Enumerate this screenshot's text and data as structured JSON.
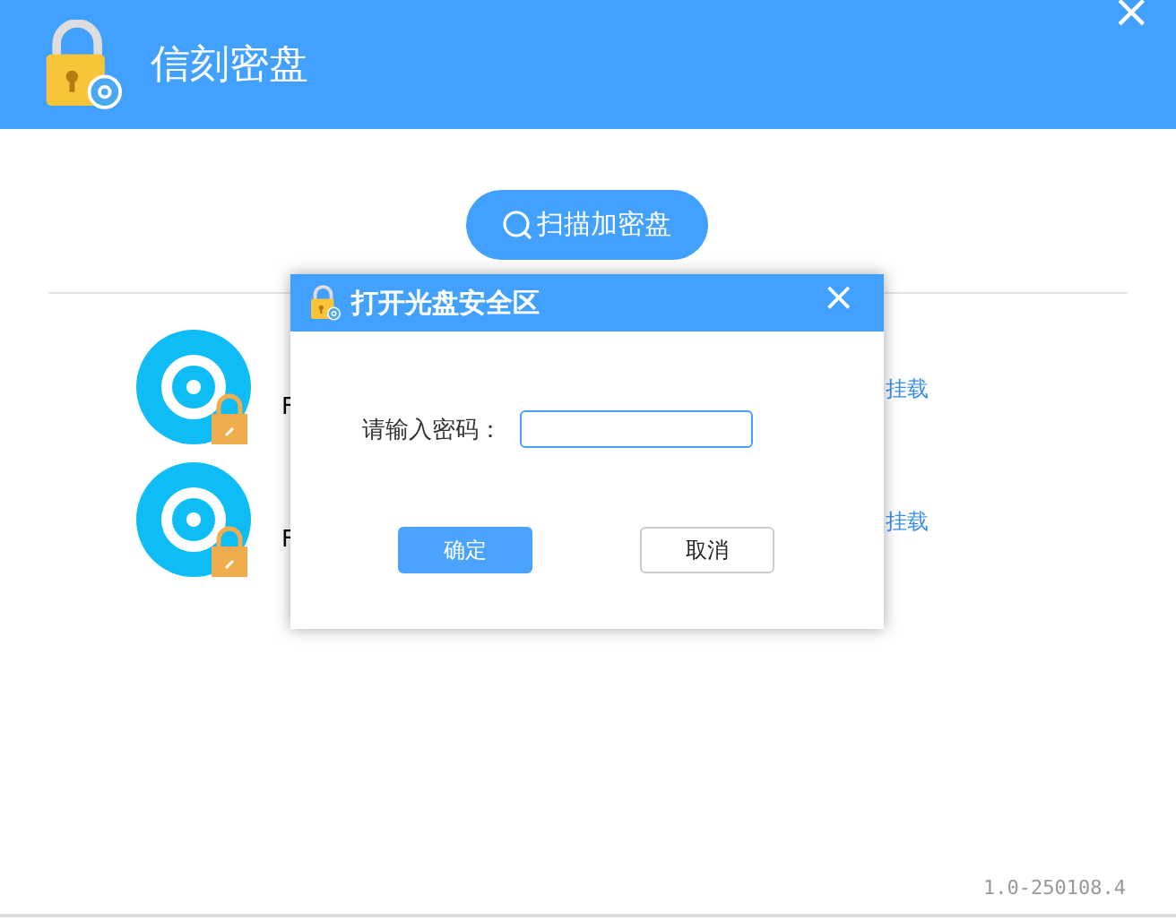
{
  "window": {
    "title": "信刻密盘",
    "close": "×"
  },
  "scan_button": {
    "label": "扫描加密盘"
  },
  "discs": [
    {
      "detail": "F",
      "action": "挂载"
    },
    {
      "detail": "F",
      "action": "挂载"
    }
  ],
  "dialog": {
    "title": "打开光盘安全区",
    "close": "×",
    "field_label": "请输入密码：",
    "buttons": [
      {
        "label": "确定",
        "primary": true
      },
      {
        "label": "取消",
        "primary": false
      }
    ]
  },
  "version": "1.0-250108.4"
}
